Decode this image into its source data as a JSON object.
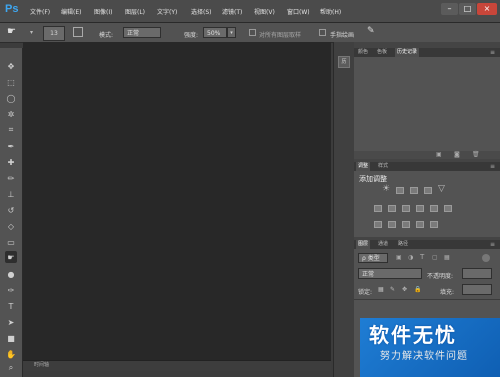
{
  "app": {
    "logo": "Ps"
  },
  "menu": [
    "文件(F)",
    "编辑(E)",
    "图像(I)",
    "图层(L)",
    "文字(Y)",
    "选择(S)",
    "滤镜(T)",
    "视图(V)",
    "窗口(W)",
    "帮助(H)"
  ],
  "window_controls": {
    "minimize": "–",
    "maximize": "□",
    "close": "×"
  },
  "options": {
    "brush_size": "13",
    "mode_label": "模式:",
    "mode_value": "正常",
    "strength_label": "强度:",
    "strength_value": "50%",
    "sample_all_label": "对所有图层取样",
    "finger_paint_label": "手指绘画"
  },
  "dock": {
    "history_icon_label": "历"
  },
  "panel_top": {
    "tabs": [
      "颜色",
      "色板",
      "历史记录"
    ]
  },
  "panel_adjust": {
    "tabs": [
      "调整",
      "样式"
    ],
    "title": "添加调整"
  },
  "panel_layers": {
    "tabs": [
      "图层",
      "通道",
      "路径"
    ],
    "filter_label": "ρ 类型",
    "blend_mode": "正常",
    "opacity_label": "不透明度:",
    "lock_label": "锁定:",
    "fill_label": "填充:"
  },
  "statusbar": {
    "timeline_label": "时间轴"
  },
  "watermark": {
    "logo": "软件无忧",
    "subtitle": "努力解决软件问题"
  },
  "colors": {
    "accent_ps": "#3ea7f1",
    "close_button": "#c8463a",
    "canvas_bg": "#282828",
    "panel_bg": "#535353"
  }
}
